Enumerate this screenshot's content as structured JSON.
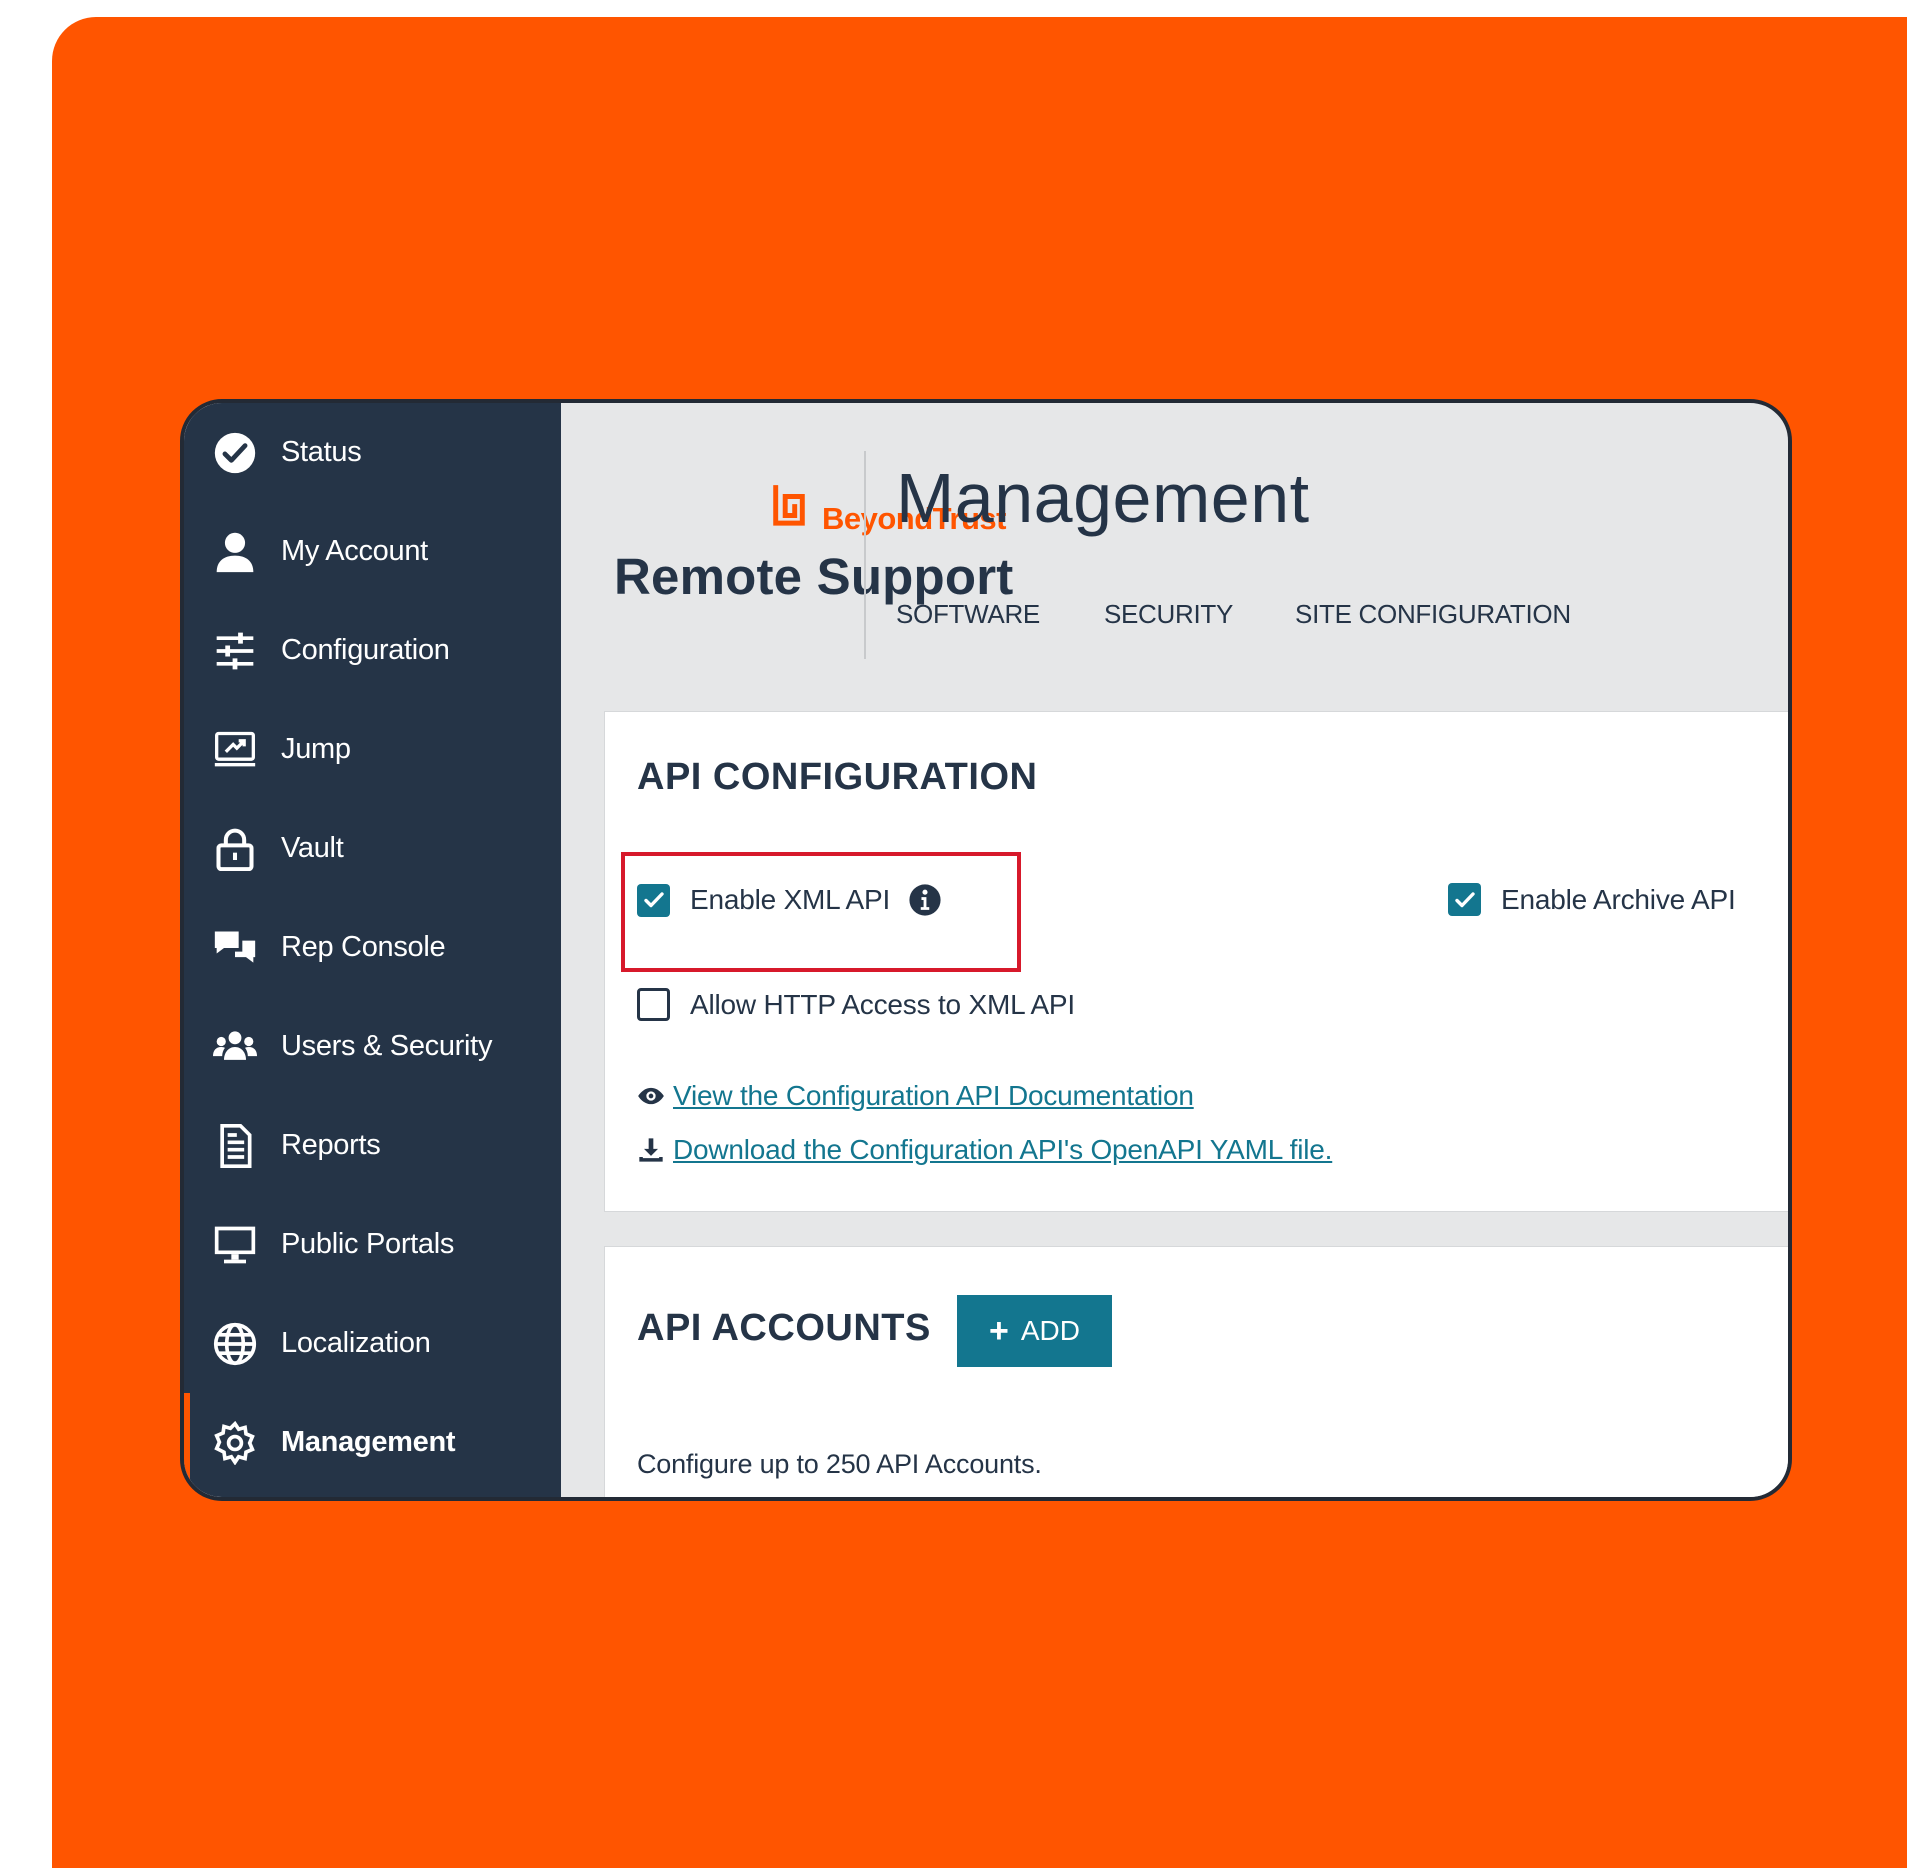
{
  "sidebar": {
    "items": [
      {
        "label": "Status",
        "icon": "check-circle-icon"
      },
      {
        "label": "My Account",
        "icon": "user-icon"
      },
      {
        "label": "Configuration",
        "icon": "sliders-icon"
      },
      {
        "label": "Jump",
        "icon": "jump-icon"
      },
      {
        "label": "Vault",
        "icon": "lock-icon"
      },
      {
        "label": "Rep Console",
        "icon": "chat-bubbles-icon"
      },
      {
        "label": "Users & Security",
        "icon": "users-icon"
      },
      {
        "label": "Reports",
        "icon": "document-icon"
      },
      {
        "label": "Public Portals",
        "icon": "monitor-icon"
      },
      {
        "label": "Localization",
        "icon": "globe-icon"
      },
      {
        "label": "Management",
        "icon": "gear-icon",
        "active": true
      }
    ]
  },
  "header": {
    "brand": "BeyondTrust",
    "product": "Remote Support",
    "title": "Management",
    "tabs": [
      "SOFTWARE",
      "SECURITY",
      "SITE CONFIGURATION"
    ]
  },
  "api_configuration": {
    "title": "API CONFIGURATION",
    "enable_xml_api": {
      "label": "Enable XML API",
      "checked": true
    },
    "enable_archive_api": {
      "label": "Enable Archive API",
      "checked": true
    },
    "allow_http": {
      "label": "Allow HTTP Access to XML API",
      "checked": false
    },
    "view_docs_link": "View the Configuration API Documentation",
    "download_yaml_link": "Download the Configuration API's OpenAPI YAML file."
  },
  "api_accounts": {
    "title": "API ACCOUNTS",
    "add_button": "ADD",
    "info": "Configure up to 250 API Accounts."
  },
  "colors": {
    "accent": "#ff5500",
    "sidebar_bg": "#253447",
    "primary": "#13768f",
    "highlight": "#d7192b"
  }
}
